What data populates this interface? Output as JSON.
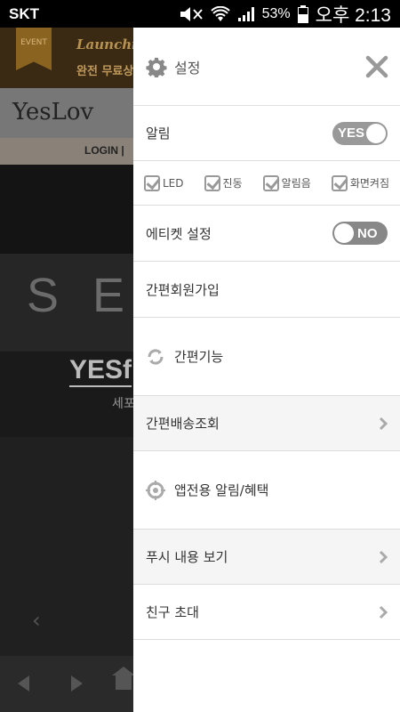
{
  "status_bar": {
    "carrier": "SKT",
    "battery": "53%",
    "time": "오후 2:13"
  },
  "background_app": {
    "event_badge": "EVENT",
    "banner_title": "Launchi",
    "banner_sub": "완전 무료상",
    "logo": "YesLov",
    "login": "LOGIN  |",
    "hero_text": "SEX",
    "brand": "YESf",
    "brand_sub": "세포",
    "prev_chevron": "‹"
  },
  "drawer": {
    "header": {
      "title": "설정"
    },
    "notification": {
      "label": "알림",
      "toggle": "YES"
    },
    "options": [
      {
        "label": "LED"
      },
      {
        "label": "진동"
      },
      {
        "label": "알림음"
      },
      {
        "label": "화면켜짐"
      }
    ],
    "etiquette": {
      "label": "에티켓 설정",
      "toggle": "NO"
    },
    "signup": {
      "label": "간편회원가입"
    },
    "quick_feature": {
      "label": "간편기능"
    },
    "delivery": {
      "label": "간편배송조회"
    },
    "app_alert": {
      "label": "앱전용 알림/혜택"
    },
    "push_view": {
      "label": "푸시 내용 보기"
    },
    "invite": {
      "label": "친구 초대"
    }
  }
}
